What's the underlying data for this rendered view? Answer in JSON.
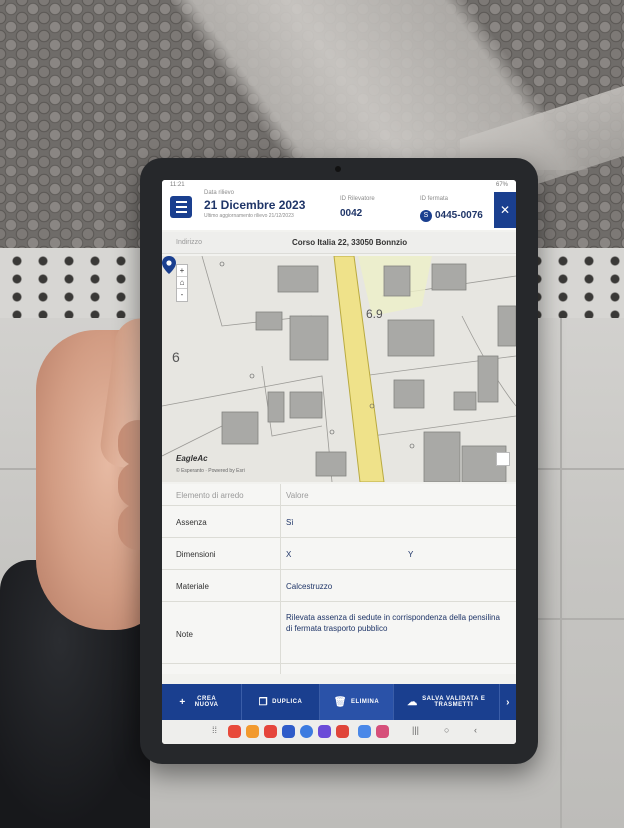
{
  "statusbar": {
    "time": "11:21",
    "carrier": "",
    "battery": "67%"
  },
  "header": {
    "date_caption": "Data rilievo",
    "date": "21 Dicembre 2023",
    "last_update": "Ultimo aggiornamento rilievo 21/12/2023",
    "surveyor_caption": "ID Rilevatore",
    "surveyor_id": "0042",
    "stop_caption": "ID fermata",
    "stop_badge": "S",
    "stop_id": "0445-0076",
    "close_icon": "close-icon",
    "menu_icon": "menu-icon"
  },
  "address": {
    "label": "Indirizzo",
    "value": "Corso Italia 22, 33050 Bonnzio"
  },
  "map": {
    "zoom_in": "+",
    "zoom_out": "-",
    "zoom_home": "⌂",
    "logo": "EagleAc",
    "credit": "© Esperanto · Powered by Esri"
  },
  "table": {
    "header": {
      "key": "Elemento di arredo",
      "value": "Valore"
    },
    "rows": [
      {
        "key": "Assenza",
        "value": "Sì"
      },
      {
        "key": "Dimensioni",
        "x_label": "X",
        "y_label": "Y"
      },
      {
        "key": "Materiale",
        "value": "Calcestruzzo"
      },
      {
        "key": "Note",
        "value": "Rilevata assenza di sedute in corrispondenza della pensilina di fermata trasporto pubblico"
      }
    ]
  },
  "toolbar": {
    "create": "CREA NUOVA",
    "duplicate": "DUPLICA",
    "delete": "ELIMINA",
    "save": "SALVA VALIDATA E TRASMETTI"
  },
  "colors": {
    "primary": "#1a3f8f",
    "road": "#efe28a",
    "building": "#a9a9a6"
  }
}
